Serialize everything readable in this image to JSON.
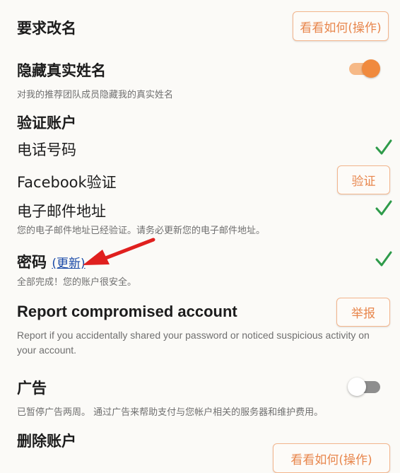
{
  "name_change": {
    "title": "要求改名",
    "button": "看看如何(操作)"
  },
  "hide_real_name": {
    "title": "隐藏真实姓名",
    "description": "对我的推荐团队成员隐藏我的真实姓名",
    "toggle_on": true,
    "accent": "#f08a3e"
  },
  "verify_account": {
    "title": "验证账户",
    "phone_label": "电话号码",
    "phone_verified": true,
    "facebook_label": "Facebook验证",
    "facebook_button": "验证",
    "email_label": "电子邮件地址",
    "email_verified": true,
    "email_description": "您的电子邮件地址已经验证。请务必更新您的电子邮件地址。"
  },
  "password": {
    "title": "密码",
    "update_link": "(更新)",
    "verified": true,
    "description": "全部完成！您的账户很安全。"
  },
  "report": {
    "title": "Report compromised account",
    "button": "举报",
    "description": "Report if you accidentally shared your password or noticed suspicious activity on your account."
  },
  "ads": {
    "title": "广告",
    "toggle_on": false,
    "description": "已暂停广告两周。 通过广告来帮助支付与您帐户相关的服务器和维护费用。"
  },
  "delete_account": {
    "title": "删除账户",
    "button": "看看如何(操作)"
  },
  "colors": {
    "check": "#2e9b4a",
    "button_text": "#e8864c",
    "button_border": "#f3b58c",
    "annotation_arrow": "#e0201e"
  },
  "icons": {
    "check": "check-icon",
    "annotation": "red-arrow-annotation"
  }
}
